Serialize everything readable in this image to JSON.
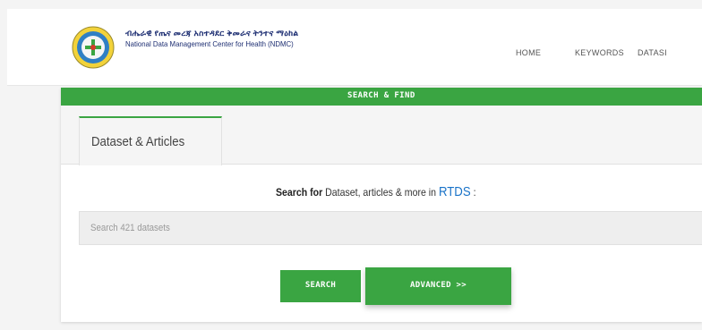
{
  "header": {
    "org_name_amharic": "ብሔራዊ የጤና መረጃ አስተዳደር ቅመራና ትንተና ማዕከል",
    "org_name": "National Data Management Center for Health (NDMC)",
    "logo_icon": "ephi-seal-icon",
    "nav": [
      {
        "label": "HOME"
      },
      {
        "label": "KEYWORDS"
      },
      {
        "label": "DATASI"
      }
    ]
  },
  "search_section": {
    "title": "SEARCH & FIND",
    "tabs": [
      {
        "label": "Dataset & Articles",
        "active": true
      }
    ],
    "prompt_bold": "Search for",
    "prompt_text": " Dataset, articles & more in ",
    "prompt_brand": "RTDS",
    "prompt_suffix": " :",
    "input": {
      "value": "",
      "placeholder": "Search 421 datasets"
    },
    "search_button": "SEARCH",
    "advanced_button": "ADVANCED >>"
  },
  "colors": {
    "accent": "#3aa542",
    "brand_text": "#1d2e72",
    "link": "#1a73c8"
  }
}
